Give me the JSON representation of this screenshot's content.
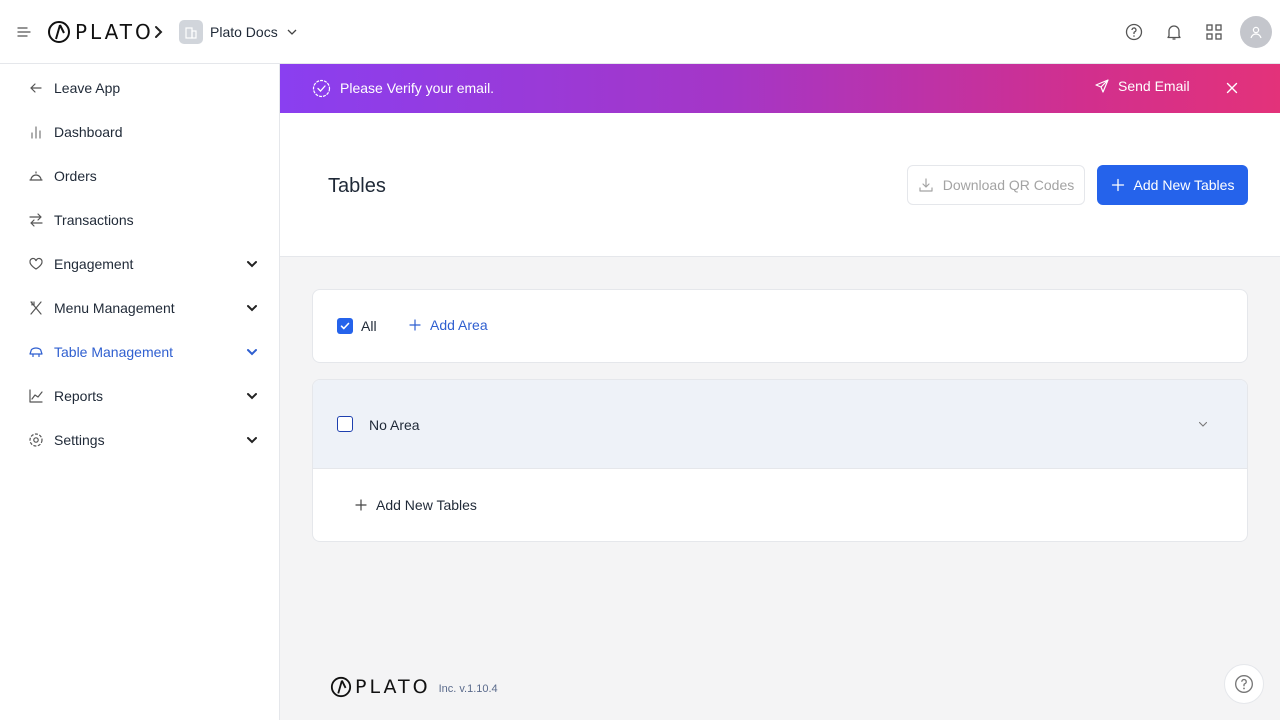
{
  "header": {
    "brand": "PLATO",
    "workspace": "Plato Docs",
    "icons": [
      "menu-icon",
      "chevron-right-icon",
      "building-icon",
      "chevron-down-icon",
      "help-icon",
      "bell-icon",
      "apps-grid-icon",
      "user-icon"
    ]
  },
  "sidebar": {
    "items": [
      {
        "label": "Leave App",
        "icon": "arrow-left-icon"
      },
      {
        "label": "Dashboard",
        "icon": "bar-chart-icon"
      },
      {
        "label": "Orders",
        "icon": "cloche-icon"
      },
      {
        "label": "Transactions",
        "icon": "transfer-icon"
      },
      {
        "label": "Engagement",
        "icon": "heart-hand-icon",
        "expandable": true
      },
      {
        "label": "Menu Management",
        "icon": "utensils-icon",
        "expandable": true
      },
      {
        "label": "Table Management",
        "icon": "table-icon",
        "expandable": true,
        "active": true
      },
      {
        "label": "Reports",
        "icon": "line-chart-icon",
        "expandable": true
      },
      {
        "label": "Settings",
        "icon": "gear-icon",
        "expandable": true
      }
    ]
  },
  "banner": {
    "message": "Please Verify your email.",
    "action": "Send Email",
    "colors": {
      "start": "#8a3ff0",
      "end": "#e3327a"
    }
  },
  "page": {
    "title": "Tables",
    "download_label": "Download QR Codes",
    "add_label": "Add New Tables"
  },
  "filter": {
    "all_label": "All",
    "all_checked": true,
    "add_area_label": "Add Area"
  },
  "areas": [
    {
      "name": "No Area",
      "checked": false,
      "add_tables_label": "Add New Tables"
    }
  ],
  "footer": {
    "brand": "PLATO",
    "version": "Inc. v.1.10.4"
  },
  "colors": {
    "accent": "#2563eb",
    "active_nav": "#2f5fd0"
  }
}
